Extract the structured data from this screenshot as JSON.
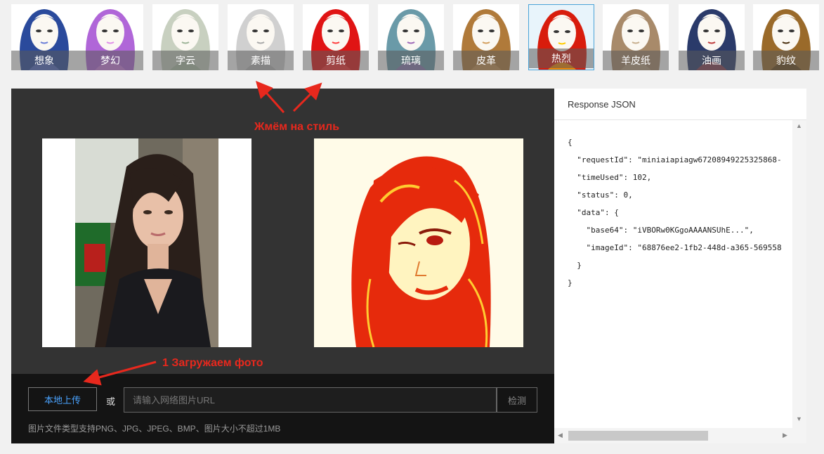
{
  "styles": [
    {
      "label": "想象",
      "icon": "woman-portrait-thumb",
      "colors": {
        "hair": "#2a4a9c",
        "accent": "#6c7fd8"
      }
    },
    {
      "label": "梦幻",
      "icon": "woman-portrait-thumb",
      "colors": {
        "hair": "#b066d8",
        "accent": "#e090e8"
      }
    },
    {
      "label": "字云",
      "icon": "woman-portrait-thumb",
      "colors": {
        "hair": "#c8d0c0",
        "accent": "#9fb59a"
      }
    },
    {
      "label": "素描",
      "icon": "woman-portrait-thumb",
      "colors": {
        "hair": "#d0d0d0",
        "accent": "#aaaaaa"
      }
    },
    {
      "label": "剪纸",
      "icon": "woman-portrait-thumb",
      "colors": {
        "hair": "#e01414",
        "accent": "#ff4040"
      }
    },
    {
      "label": "琉璃",
      "icon": "woman-portrait-thumb",
      "colors": {
        "hair": "#6a9aa8",
        "accent": "#a06ab8"
      }
    },
    {
      "label": "皮革",
      "icon": "woman-portrait-thumb",
      "colors": {
        "hair": "#b07a3a",
        "accent": "#d4a060"
      }
    },
    {
      "label": "热烈",
      "icon": "woman-portrait-thumb",
      "colors": {
        "hair": "#d81c0c",
        "accent": "#ffcc00"
      }
    },
    {
      "label": "羊皮纸",
      "icon": "woman-portrait-thumb",
      "colors": {
        "hair": "#a88a6a",
        "accent": "#c8b090"
      }
    },
    {
      "label": "油画",
      "icon": "woman-portrait-thumb",
      "colors": {
        "hair": "#2a3a6a",
        "accent": "#c04040"
      }
    },
    {
      "label": "豹纹",
      "icon": "woman-portrait-thumb",
      "colors": {
        "hair": "#9a6a2a",
        "accent": "#4a3010"
      }
    }
  ],
  "active_style_index": 7,
  "preview": {
    "original_icon": "original-portrait-photo",
    "result_icon": "stylized-portrait-result",
    "result_colors": {
      "primary": "#e62a0c",
      "secondary": "#ffe680",
      "background": "#fffbe0"
    }
  },
  "upload": {
    "button_label": "本地上传",
    "or_label": "或",
    "url_placeholder": "请输入网络图片URL",
    "detect_label": "检测",
    "hint": "图片文件类型支持PNG、JPG、JPEG、BMP、图片大小不超过1MB"
  },
  "response": {
    "title": "Response JSON",
    "lines": [
      "{",
      "  \"requestId\": \"miniaiapiagw67208949225325868-",
      "  \"timeUsed\": 102,",
      "  \"status\": 0,",
      "  \"data\": {",
      "    \"base64\": \"iVBORw0KGgoAAAANSUhE...\",",
      "    \"imageId\": \"68876ee2-1fb2-448d-a365-569558",
      "  }",
      "}"
    ]
  },
  "annotations": {
    "style_hint": "Жмём на стиль",
    "upload_hint": "1 Загружаем фото",
    "color": "#e8281d"
  },
  "scrollbars": {
    "up_arrow": "▲",
    "down_arrow": "▼",
    "left_arrow": "◀",
    "right_arrow": "▶"
  }
}
